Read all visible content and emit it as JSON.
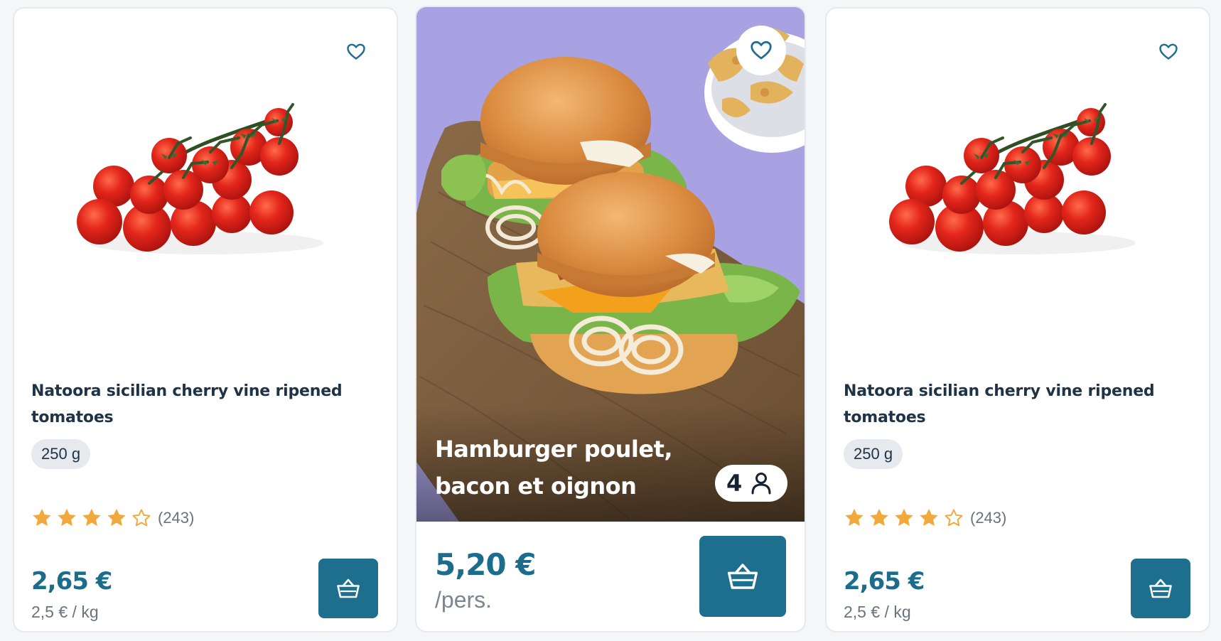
{
  "colors": {
    "accent": "#1e6e8e",
    "price": "#1c6c8c",
    "star": "#f2a93b",
    "title": "#1f3347",
    "badge_bg": "#e6e9ee",
    "recipe_bg": "#a9a2e2"
  },
  "products": [
    {
      "name": "Natoora sicilian cherry vine ripened tomatoes",
      "weight": "250 g",
      "rating": 4,
      "rating_max": 5,
      "reviews": "(243)",
      "price": "2,65 €",
      "unit_price": "2,5 € / kg",
      "favorite_icon": "heart-outline-icon",
      "cart_icon": "basket-icon"
    },
    {
      "name": "Natoora sicilian cherry vine ripened tomatoes",
      "weight": "250 g",
      "rating": 4,
      "rating_max": 5,
      "reviews": "(243)",
      "price": "2,65 €",
      "unit_price": "2,5 € / kg",
      "favorite_icon": "heart-outline-icon",
      "cart_icon": "basket-icon"
    }
  ],
  "recipe": {
    "title": "Hamburger poulet, bacon et oignon",
    "servings": "4",
    "servings_icon": "person-icon",
    "price": "5,20 €",
    "unit": "/pers.",
    "favorite_icon": "heart-outline-icon",
    "cart_icon": "basket-icon"
  }
}
